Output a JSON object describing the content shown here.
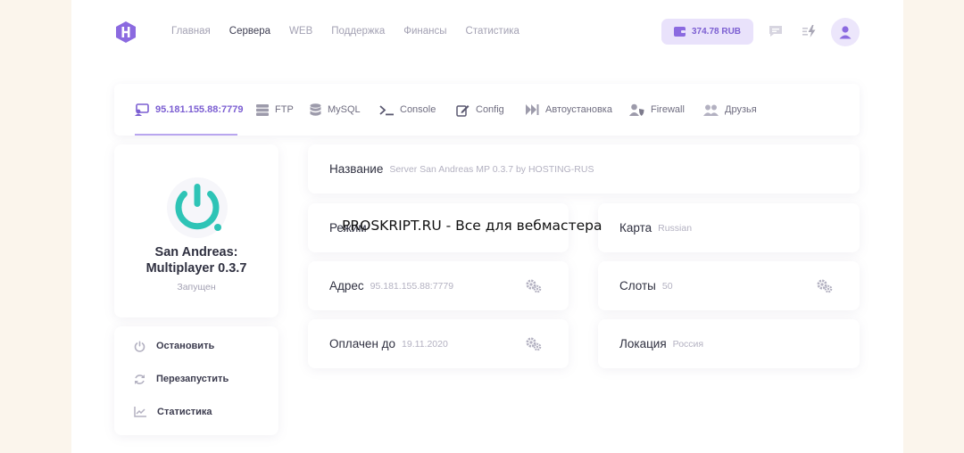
{
  "header": {
    "nav": [
      {
        "label": "Главная",
        "active": false
      },
      {
        "label": "Сервера",
        "active": true
      },
      {
        "label": "WEB",
        "active": false
      },
      {
        "label": "Поддержка",
        "active": false
      },
      {
        "label": "Финансы",
        "active": false
      },
      {
        "label": "Статистика",
        "active": false
      }
    ],
    "balance": "374.78 RUB"
  },
  "tabs": [
    {
      "label": "95.181.155.88:7779",
      "icon": "server-user-icon",
      "active": true
    },
    {
      "label": "FTP",
      "icon": "ftp-icon",
      "active": false
    },
    {
      "label": "MySQL",
      "icon": "database-icon",
      "active": false
    },
    {
      "label": "Console",
      "icon": "terminal-icon",
      "active": false
    },
    {
      "label": "Config",
      "icon": "edit-icon",
      "active": false
    },
    {
      "label": "Автоустановка",
      "icon": "fast-forward-icon",
      "active": false
    },
    {
      "label": "Firewall",
      "icon": "user-shield-icon",
      "active": false
    },
    {
      "label": "Друзья",
      "icon": "users-icon",
      "active": false
    }
  ],
  "server": {
    "game_line1": "San Andreas:",
    "game_line2": "Multiplayer 0.3.7",
    "status": "Запущен",
    "power_color": "#2ec4b6"
  },
  "actions": [
    {
      "label": "Остановить",
      "icon": "power-icon"
    },
    {
      "label": "Перезапустить",
      "icon": "refresh-icon"
    },
    {
      "label": "Статистика",
      "icon": "chart-icon"
    }
  ],
  "info": {
    "name": {
      "label": "Название",
      "value": "Server San Andreas MP 0.3.7 by HOSTING-RUS"
    },
    "mode": {
      "label": "Режим",
      "value": ""
    },
    "map": {
      "label": "Карта",
      "value": "Russian"
    },
    "address": {
      "label": "Адрес",
      "value": "95.181.155.88:7779"
    },
    "slots": {
      "label": "Слоты",
      "value": "50"
    },
    "paid": {
      "label": "Оплачен до",
      "value": "19.11.2020"
    },
    "location": {
      "label": "Локация",
      "value": "Россия"
    }
  },
  "watermark": "PROSKRIPT.RU - Все для вебмастера",
  "colors": {
    "accent": "#7c5fd2",
    "power": "#2ec4b6",
    "page_bg": "#fbf5ec"
  }
}
